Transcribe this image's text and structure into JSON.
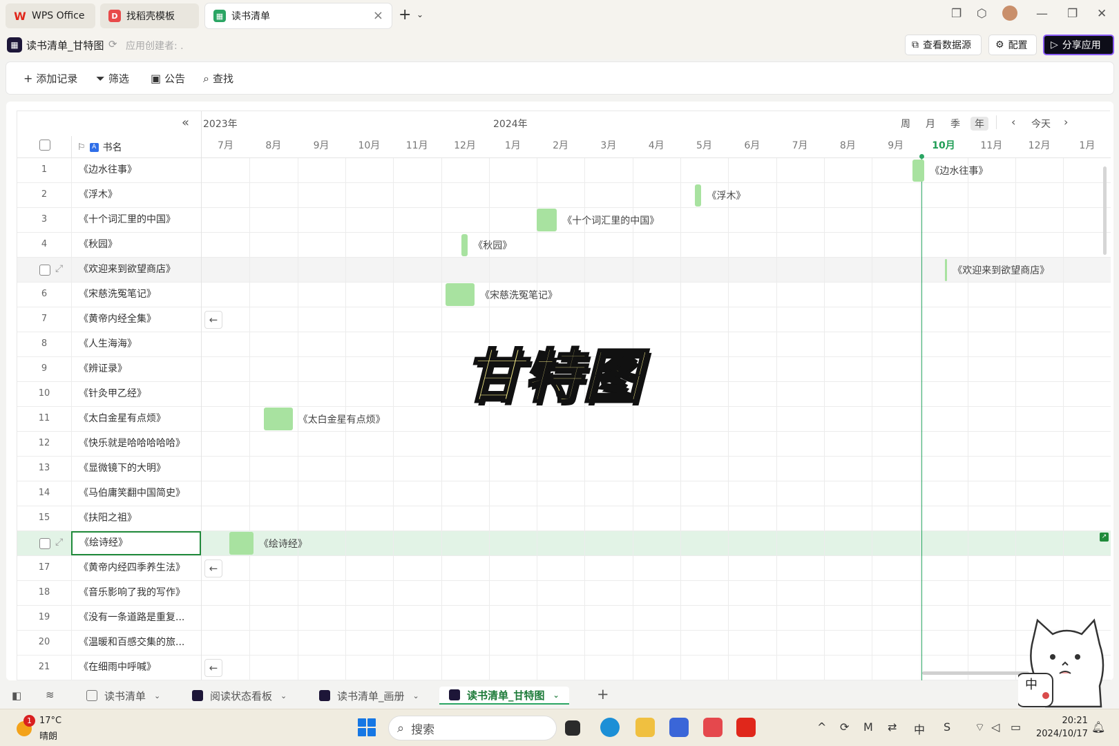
{
  "window": {
    "tabs": [
      {
        "label": "WPS Office"
      },
      {
        "label": "找稻壳模板"
      },
      {
        "label": "读书清单"
      }
    ],
    "new_tab": "+"
  },
  "app": {
    "title": "读书清单_甘特图",
    "creator": "应用创建者: .",
    "buttons": {
      "datasource": "查看数据源",
      "config": "配置",
      "share": "分享应用"
    }
  },
  "toolbar": {
    "add": "添加记录",
    "filter": "筛选",
    "notice": "公告",
    "find": "查找"
  },
  "grid": {
    "column_header": "书名",
    "rows": [
      {
        "num": "1",
        "name": "《边水往事》"
      },
      {
        "num": "2",
        "name": "《浮木》"
      },
      {
        "num": "3",
        "name": "《十个词汇里的中国》"
      },
      {
        "num": "4",
        "name": "《秋园》"
      },
      {
        "num": "",
        "name": "《欢迎来到欲望商店》"
      },
      {
        "num": "6",
        "name": "《宋慈洗冤笔记》"
      },
      {
        "num": "7",
        "name": "《黄帝内经全集》"
      },
      {
        "num": "8",
        "name": "《人生海海》"
      },
      {
        "num": "9",
        "name": "《辨证录》"
      },
      {
        "num": "10",
        "name": "《针灸甲乙经》"
      },
      {
        "num": "11",
        "name": "《太白金星有点烦》"
      },
      {
        "num": "12",
        "name": "《快乐就是哈哈哈哈哈》"
      },
      {
        "num": "13",
        "name": "《显微镜下的大明》"
      },
      {
        "num": "14",
        "name": "《马伯庸笑翻中国简史》"
      },
      {
        "num": "15",
        "name": "《扶阳之祖》"
      },
      {
        "num": "",
        "name": "《绘诗经》"
      },
      {
        "num": "17",
        "name": "《黄帝内经四季养生法》"
      },
      {
        "num": "18",
        "name": "《音乐影响了我的写作》"
      },
      {
        "num": "19",
        "name": "《没有一条道路是重复..."
      },
      {
        "num": "20",
        "name": "《温暖和百感交集的旅..."
      },
      {
        "num": "21",
        "name": "《在细雨中呼喊》"
      }
    ]
  },
  "timeline": {
    "years": [
      "2023年",
      "2024年"
    ],
    "months": [
      "7月",
      "8月",
      "9月",
      "10月",
      "11月",
      "12月",
      "1月",
      "2月",
      "3月",
      "4月",
      "5月",
      "6月",
      "7月",
      "8月",
      "9月",
      "10月",
      "11月",
      "12月",
      "1月"
    ],
    "current_month": "10月",
    "scales": [
      "周",
      "月",
      "季",
      "年"
    ],
    "active_scale": "年",
    "today": "今天",
    "bars": [
      {
        "row": 0,
        "label": "《边水往事》",
        "start_month": 14.85,
        "span": 0.25
      },
      {
        "row": 1,
        "label": "《浮木》",
        "start_month": 10.3,
        "span": 0.14
      },
      {
        "row": 2,
        "label": "《十个词汇里的中国》",
        "start_month": 7.0,
        "span": 0.42
      },
      {
        "row": 3,
        "label": "《秋园》",
        "start_month": 5.42,
        "span": 0.14
      },
      {
        "row": 4,
        "label": "《欢迎来到欲望商店》",
        "start_month": 15.53,
        "span": 0.04
      },
      {
        "row": 5,
        "label": "《宋慈洗冤笔记》",
        "start_month": 5.1,
        "span": 0.6
      },
      {
        "row": 10,
        "label": "《太白金星有点烦》",
        "start_month": 1.3,
        "span": 0.6
      },
      {
        "row": 15,
        "label": "《绘诗经》",
        "start_month": 0.58,
        "span": 0.5
      }
    ],
    "off_screen_rows": [
      6,
      16,
      20
    ]
  },
  "watermark": "甘特图",
  "sheets": [
    {
      "label": "读书清单",
      "active": false
    },
    {
      "label": "阅读状态看板",
      "active": false
    },
    {
      "label": "读书清单_画册",
      "active": false
    },
    {
      "label": "读书清单_甘特图",
      "active": true
    }
  ],
  "taskbar": {
    "weather_badge": "1",
    "temp": "17°C",
    "weather": "晴朗",
    "search": "搜索",
    "time": "20:21",
    "date": "2024/10/17"
  },
  "cat_sticker": "中",
  "colors": {
    "bar": "#a8e2a0",
    "today": "#2aa563",
    "accent": "#1f8a3a",
    "share_bg": "#0d0d18"
  }
}
